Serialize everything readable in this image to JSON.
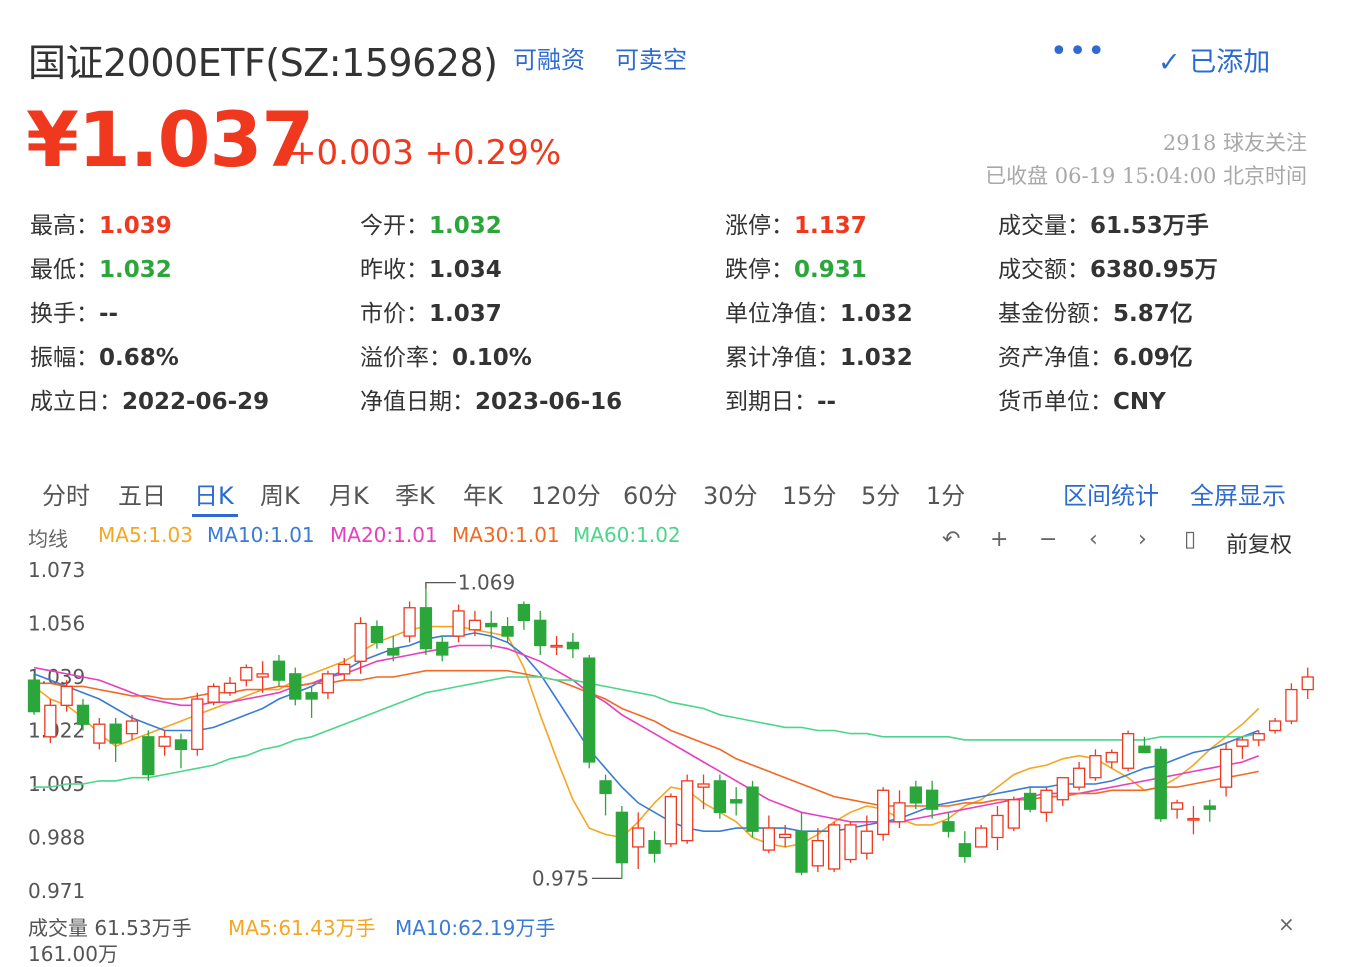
{
  "header": {
    "title": "国证2000ETF(SZ:159628)",
    "tag_margin": "可融资",
    "tag_short": "可卖空",
    "more_label": "•••",
    "added_label": "✓ 已添加",
    "price": "¥1.037",
    "change": "+0.003 +0.29%",
    "followers": "2918  球友关注",
    "status": "已收盘 06-19 15:04:00 北京时间"
  },
  "stats": [
    {
      "label": "最高：",
      "value": "1.039",
      "color": "red"
    },
    {
      "label": "今开：",
      "value": "1.032",
      "color": "green"
    },
    {
      "label": "涨停：",
      "value": "1.137",
      "color": "red"
    },
    {
      "label": "成交量：",
      "value": "61.53万手",
      "color": ""
    },
    {
      "label": "最低：",
      "value": "1.032",
      "color": "green"
    },
    {
      "label": "昨收：",
      "value": "1.034",
      "color": ""
    },
    {
      "label": "跌停：",
      "value": "0.931",
      "color": "green"
    },
    {
      "label": "成交额：",
      "value": "6380.95万",
      "color": ""
    },
    {
      "label": "换手：",
      "value": "--",
      "color": ""
    },
    {
      "label": "市价：",
      "value": "1.037",
      "color": ""
    },
    {
      "label": "单位净值：",
      "value": "1.032",
      "color": ""
    },
    {
      "label": "基金份额：",
      "value": "5.87亿",
      "color": ""
    },
    {
      "label": "振幅：",
      "value": "0.68%",
      "color": ""
    },
    {
      "label": "溢价率：",
      "value": "0.10%",
      "color": ""
    },
    {
      "label": "累计净值：",
      "value": "1.032",
      "color": ""
    },
    {
      "label": "资产净值：",
      "value": "6.09亿",
      "color": ""
    },
    {
      "label": "成立日：",
      "value": "2022-06-29",
      "color": ""
    },
    {
      "label": "净值日期：",
      "value": "2023-06-16",
      "color": ""
    },
    {
      "label": "到期日：",
      "value": "--",
      "color": ""
    },
    {
      "label": "货币单位：",
      "value": "CNY",
      "color": ""
    }
  ],
  "tabs": [
    "分时",
    "五日",
    "日K",
    "周K",
    "月K",
    "季K",
    "年K",
    "120分",
    "60分",
    "30分",
    "15分",
    "5分",
    "1分"
  ],
  "active_tab": "日K",
  "links": {
    "range_stats": "区间统计",
    "fullscreen": "全屏显示"
  },
  "ma_legend": {
    "label": "均线",
    "ma5": "MA5:1.03",
    "ma10": "MA10:1.01",
    "ma20": "MA20:1.01",
    "ma30": "MA30:1.01",
    "ma60": "MA60:1.02"
  },
  "controls": {
    "undo": "↶",
    "zoom_in": "+",
    "zoom_out": "−",
    "prev": "‹",
    "next": "›",
    "adjust_icon": "▯",
    "adjust": "前复权"
  },
  "colors": {
    "up": "#f0381f",
    "down": "#2aa63a",
    "accent": "#2e6bd0",
    "ma5": "#f5a623",
    "ma10": "#3a7bd5",
    "ma20": "#e63fbf",
    "ma30": "#f06a24",
    "ma60": "#4cd68a"
  },
  "volume": {
    "label": "成交量 61.53万手",
    "ma5": "MA5:61.43万手",
    "ma10": "MA10:62.19万手",
    "close_icon": "×",
    "partial_value": "161.00万"
  },
  "chart_data": {
    "type": "candlestick",
    "y_ticks": [
      "1.073",
      "1.056",
      "1.039",
      "1.022",
      "1.005",
      "0.988",
      "0.971"
    ],
    "ylim": [
      0.971,
      1.073
    ],
    "high_annotation": "1.069",
    "low_annotation": "0.975",
    "candles": [
      [
        1.038,
        1.028,
        1.04,
        1.027
      ],
      [
        1.02,
        1.03,
        1.032,
        1.018
      ],
      [
        1.03,
        1.036,
        1.038,
        1.028
      ],
      [
        1.03,
        1.024,
        1.032,
        1.022
      ],
      [
        1.018,
        1.024,
        1.026,
        1.016
      ],
      [
        1.024,
        1.018,
        1.026,
        1.012
      ],
      [
        1.021,
        1.025,
        1.027,
        1.019
      ],
      [
        1.02,
        1.008,
        1.022,
        1.006
      ],
      [
        1.017,
        1.02,
        1.022,
        1.014
      ],
      [
        1.019,
        1.016,
        1.021,
        1.01
      ],
      [
        1.016,
        1.032,
        1.034,
        1.014
      ],
      [
        1.031,
        1.036,
        1.037,
        1.03
      ],
      [
        1.034,
        1.037,
        1.039,
        1.033
      ],
      [
        1.038,
        1.042,
        1.043,
        1.036
      ],
      [
        1.039,
        1.04,
        1.044,
        1.034
      ],
      [
        1.044,
        1.038,
        1.046,
        1.036
      ],
      [
        1.04,
        1.032,
        1.042,
        1.03
      ],
      [
        1.034,
        1.032,
        1.036,
        1.026
      ],
      [
        1.034,
        1.04,
        1.041,
        1.032
      ],
      [
        1.04,
        1.043,
        1.045,
        1.038
      ],
      [
        1.044,
        1.056,
        1.058,
        1.04
      ],
      [
        1.055,
        1.05,
        1.057,
        1.048
      ],
      [
        1.048,
        1.046,
        1.052,
        1.044
      ],
      [
        1.052,
        1.061,
        1.063,
        1.05
      ],
      [
        1.061,
        1.048,
        1.069,
        1.046
      ],
      [
        1.05,
        1.046,
        1.052,
        1.044
      ],
      [
        1.052,
        1.06,
        1.062,
        1.05
      ],
      [
        1.054,
        1.057,
        1.06,
        1.052
      ],
      [
        1.056,
        1.055,
        1.06,
        1.048
      ],
      [
        1.055,
        1.052,
        1.058,
        1.05
      ],
      [
        1.062,
        1.057,
        1.063,
        1.054
      ],
      [
        1.057,
        1.049,
        1.06,
        1.046
      ],
      [
        1.049,
        1.049,
        1.052,
        1.046
      ],
      [
        1.05,
        1.048,
        1.053,
        1.045
      ],
      [
        1.045,
        1.012,
        1.046,
        1.01
      ],
      [
        1.006,
        1.002,
        1.008,
        0.995
      ],
      [
        0.996,
        0.98,
        0.998,
        0.975
      ],
      [
        0.985,
        0.991,
        0.996,
        0.978
      ],
      [
        0.987,
        0.983,
        0.99,
        0.98
      ],
      [
        0.986,
        1.001,
        1.002,
        0.985
      ],
      [
        0.987,
        1.006,
        1.008,
        0.986
      ],
      [
        1.004,
        1.005,
        1.008,
        0.997
      ],
      [
        1.006,
        0.996,
        1.008,
        0.994
      ],
      [
        1.0,
        0.999,
        1.004,
        0.995
      ],
      [
        1.004,
        0.99,
        1.006,
        0.988
      ],
      [
        0.984,
        0.991,
        0.995,
        0.983
      ],
      [
        0.988,
        0.989,
        0.992,
        0.985
      ],
      [
        0.99,
        0.977,
        0.996,
        0.976
      ],
      [
        0.979,
        0.987,
        0.991,
        0.977
      ],
      [
        0.978,
        0.992,
        0.993,
        0.977
      ],
      [
        0.981,
        0.992,
        0.993,
        0.98
      ],
      [
        0.983,
        0.99,
        0.995,
        0.981
      ],
      [
        0.989,
        1.003,
        1.004,
        0.987
      ],
      [
        0.993,
        0.999,
        1.003,
        0.991
      ],
      [
        1.004,
        0.999,
        1.006,
        0.997
      ],
      [
        1.003,
        0.997,
        1.006,
        0.994
      ],
      [
        0.993,
        0.99,
        0.996,
        0.988
      ],
      [
        0.986,
        0.982,
        0.99,
        0.98
      ],
      [
        0.985,
        0.991,
        0.992,
        0.986
      ],
      [
        0.988,
        0.995,
        0.998,
        0.984
      ],
      [
        0.991,
        1.0,
        1.001,
        0.99
      ],
      [
        1.002,
        0.997,
        1.004,
        0.996
      ],
      [
        0.996,
        1.003,
        1.004,
        0.993
      ],
      [
        1.0,
        1.007,
        1.007,
        0.998
      ],
      [
        1.004,
        1.01,
        1.012,
        1.003
      ],
      [
        1.007,
        1.014,
        1.016,
        1.006
      ],
      [
        1.012,
        1.015,
        1.016,
        1.01
      ],
      [
        1.01,
        1.021,
        1.022,
        1.009
      ],
      [
        1.017,
        1.015,
        1.02,
        1.016
      ],
      [
        1.016,
        0.994,
        1.017,
        0.993
      ],
      [
        0.997,
        0.999,
        1.0,
        0.994
      ],
      [
        0.994,
        0.994,
        0.998,
        0.989
      ],
      [
        0.998,
        0.997,
        1.0,
        0.993
      ],
      [
        1.004,
        1.016,
        1.018,
        1.001
      ],
      [
        1.017,
        1.019,
        1.02,
        1.013
      ],
      [
        1.019,
        1.021,
        1.022,
        1.017
      ],
      [
        1.022,
        1.025,
        1.026,
        1.021
      ],
      [
        1.025,
        1.035,
        1.037,
        1.024
      ],
      [
        1.035,
        1.039,
        1.042,
        1.032
      ]
    ],
    "series": [
      {
        "name": "MA5",
        "values": [
          1.036,
          1.032,
          1.03,
          1.026,
          1.021,
          1.017,
          1.019,
          1.021,
          1.023,
          1.025,
          1.027,
          1.029,
          1.031,
          1.033,
          1.035,
          1.035,
          1.038,
          1.04,
          1.042,
          1.044,
          1.047,
          1.05,
          1.052,
          1.054,
          1.055,
          1.055,
          1.055,
          1.054,
          1.053,
          1.052,
          1.042,
          1.027,
          1.013,
          1.0,
          0.991,
          0.989,
          0.988,
          0.993,
          0.999,
          1.004,
          1.003,
          0.999,
          0.996,
          0.993,
          0.988,
          0.986,
          0.985,
          0.986,
          0.989,
          0.993,
          0.996,
          0.998,
          0.997,
          0.994,
          0.992,
          0.992,
          0.994,
          0.998,
          1.0,
          1.004,
          1.008,
          1.01,
          1.011,
          1.013,
          1.014,
          1.013,
          1.01,
          1.007,
          1.003,
          1.004,
          1.007,
          1.011,
          1.016,
          1.02,
          1.024,
          1.029
        ]
      },
      {
        "name": "MA10",
        "values": [
          1.04,
          1.038,
          1.036,
          1.034,
          1.032,
          1.029,
          1.026,
          1.024,
          1.022,
          1.022,
          1.022,
          1.023,
          1.025,
          1.027,
          1.029,
          1.032,
          1.034,
          1.036,
          1.039,
          1.041,
          1.044,
          1.046,
          1.048,
          1.049,
          1.051,
          1.052,
          1.052,
          1.053,
          1.052,
          1.05,
          1.046,
          1.04,
          1.032,
          1.024,
          1.016,
          1.01,
          1.004,
          0.999,
          0.996,
          0.993,
          0.991,
          0.99,
          0.99,
          0.991,
          0.991,
          0.991,
          0.991,
          0.99,
          0.99,
          0.99,
          0.991,
          0.992,
          0.993,
          0.994,
          0.996,
          0.998,
          0.999,
          1.0,
          1.001,
          1.002,
          1.003,
          1.004,
          1.004,
          1.005,
          1.005,
          1.005,
          1.006,
          1.008,
          1.01,
          1.011,
          1.013,
          1.015,
          1.016,
          1.018,
          1.02,
          1.022
        ]
      },
      {
        "name": "MA20",
        "values": [
          1.042,
          1.041,
          1.04,
          1.039,
          1.038,
          1.036,
          1.034,
          1.032,
          1.031,
          1.03,
          1.03,
          1.031,
          1.031,
          1.032,
          1.033,
          1.034,
          1.036,
          1.037,
          1.039,
          1.04,
          1.042,
          1.044,
          1.045,
          1.046,
          1.047,
          1.048,
          1.049,
          1.049,
          1.049,
          1.048,
          1.046,
          1.044,
          1.041,
          1.038,
          1.034,
          1.031,
          1.027,
          1.024,
          1.021,
          1.018,
          1.015,
          1.012,
          1.009,
          1.006,
          1.003,
          1.0,
          0.998,
          0.996,
          0.995,
          0.994,
          0.993,
          0.993,
          0.993,
          0.993,
          0.994,
          0.995,
          0.996,
          0.997,
          0.998,
          0.999,
          1.0,
          1.001,
          1.002,
          1.002,
          1.002,
          1.003,
          1.004,
          1.005,
          1.006,
          1.007,
          1.008,
          1.009,
          1.01,
          1.011,
          1.012,
          1.014
        ]
      },
      {
        "name": "MA30",
        "values": [
          1.037,
          1.037,
          1.036,
          1.036,
          1.035,
          1.034,
          1.033,
          1.033,
          1.032,
          1.032,
          1.033,
          1.034,
          1.034,
          1.035,
          1.035,
          1.036,
          1.036,
          1.037,
          1.037,
          1.038,
          1.038,
          1.039,
          1.039,
          1.04,
          1.041,
          1.041,
          1.041,
          1.041,
          1.041,
          1.041,
          1.04,
          1.039,
          1.038,
          1.036,
          1.034,
          1.032,
          1.029,
          1.027,
          1.025,
          1.022,
          1.02,
          1.018,
          1.016,
          1.013,
          1.011,
          1.009,
          1.007,
          1.005,
          1.003,
          1.001,
          1.0,
          0.999,
          0.998,
          0.998,
          0.998,
          0.998,
          0.998,
          0.999,
          0.999,
          1.0,
          1.0,
          1.0,
          1.001,
          1.001,
          1.002,
          1.002,
          1.003,
          1.003,
          1.003,
          1.004,
          1.004,
          1.005,
          1.006,
          1.007,
          1.008,
          1.009
        ]
      },
      {
        "name": "MA60",
        "values": [
          1.004,
          1.004,
          1.005,
          1.005,
          1.006,
          1.006,
          1.007,
          1.007,
          1.008,
          1.009,
          1.01,
          1.011,
          1.013,
          1.014,
          1.016,
          1.017,
          1.019,
          1.02,
          1.022,
          1.024,
          1.026,
          1.028,
          1.03,
          1.032,
          1.034,
          1.035,
          1.036,
          1.037,
          1.038,
          1.039,
          1.039,
          1.039,
          1.038,
          1.038,
          1.037,
          1.036,
          1.035,
          1.034,
          1.033,
          1.031,
          1.03,
          1.029,
          1.027,
          1.026,
          1.025,
          1.024,
          1.023,
          1.023,
          1.022,
          1.022,
          1.021,
          1.021,
          1.02,
          1.02,
          1.02,
          1.02,
          1.02,
          1.019,
          1.019,
          1.019,
          1.019,
          1.019,
          1.019,
          1.019,
          1.019,
          1.019,
          1.019,
          1.019,
          1.019,
          1.02,
          1.02,
          1.02,
          1.02,
          1.02,
          1.02,
          1.021
        ]
      }
    ]
  }
}
